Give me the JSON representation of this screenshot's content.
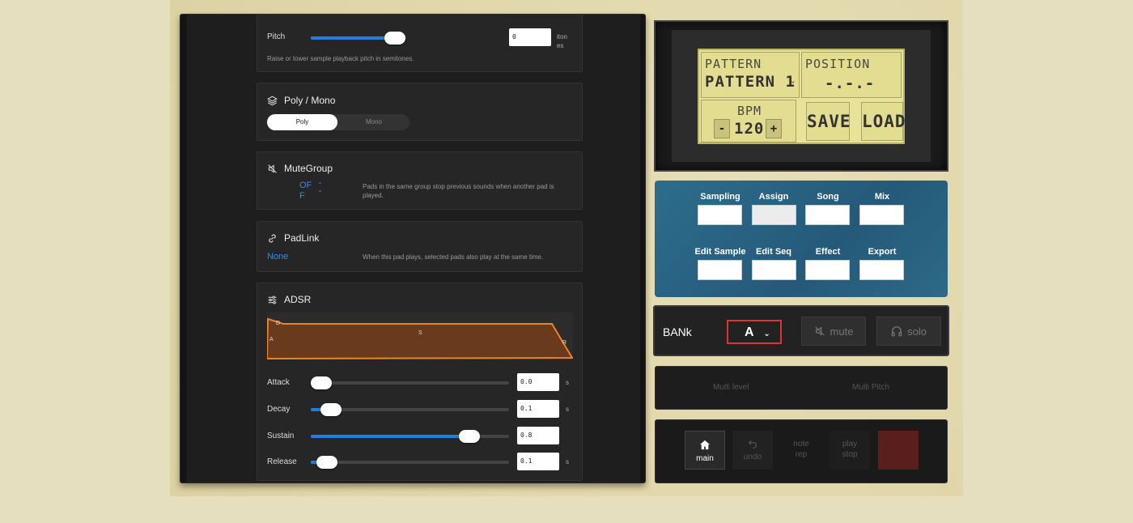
{
  "pitch": {
    "label": "Pitch",
    "value": "0",
    "unit": "itones",
    "desc": "Raise or lower sample playback pitch in semitones.",
    "fraction": 0.88
  },
  "poly": {
    "title": "Poly / Mono",
    "options": [
      "Poly",
      "Mono"
    ],
    "selected": "Poly"
  },
  "mutegroup": {
    "title": "MuteGroup",
    "value": "OFF",
    "desc": "Pads in the same group stop previous sounds when another pad is played."
  },
  "padlink": {
    "title": "PadLink",
    "value": "None",
    "desc": "When this pad plays, selected pads also play at the same time."
  },
  "adsr": {
    "title": "ADSR",
    "graph_labels": {
      "a": "A",
      "d": "D",
      "s": "S",
      "r": "R"
    },
    "params": [
      {
        "label": "Attack",
        "value": "0.0",
        "unit": "s",
        "fraction": 0.05
      },
      {
        "label": "Decay",
        "value": "0.1",
        "unit": "s",
        "fraction": 0.1
      },
      {
        "label": "Sustain",
        "value": "0.8",
        "unit": "",
        "fraction": 0.8
      },
      {
        "label": "Release",
        "value": "0.1",
        "unit": "s",
        "fraction": 0.08
      }
    ]
  },
  "lcd": {
    "pattern_label": "PATTERN",
    "pattern_value": "PATTERN 1",
    "position_label": "POSITION",
    "position_value": "-.-.-",
    "bpm_label": "BPM",
    "bpm_value": "120",
    "minus": "-",
    "plus": "+",
    "save": "SAVE",
    "load": "LOAD"
  },
  "modes": [
    {
      "label": "Sampling"
    },
    {
      "label": "Assign"
    },
    {
      "label": "Song"
    },
    {
      "label": "Mix"
    },
    {
      "label": "Edit Sample"
    },
    {
      "label": "Edit Seq"
    },
    {
      "label": "Effect"
    },
    {
      "label": "Export"
    }
  ],
  "bank": {
    "label": "BANk",
    "value": "A",
    "mute": "mute",
    "solo": "solo"
  },
  "multi": {
    "level": "Multi level",
    "pitch": "Multi Pitch"
  },
  "transport": {
    "main": "main",
    "undo": "undo",
    "note_rep_1": "note",
    "note_rep_2": "rep",
    "play_1": "play",
    "play_2": "stop"
  },
  "colors": {
    "accent": "#1f7fe0",
    "lcd": "#e8e398",
    "envelope": "#e8842c"
  }
}
